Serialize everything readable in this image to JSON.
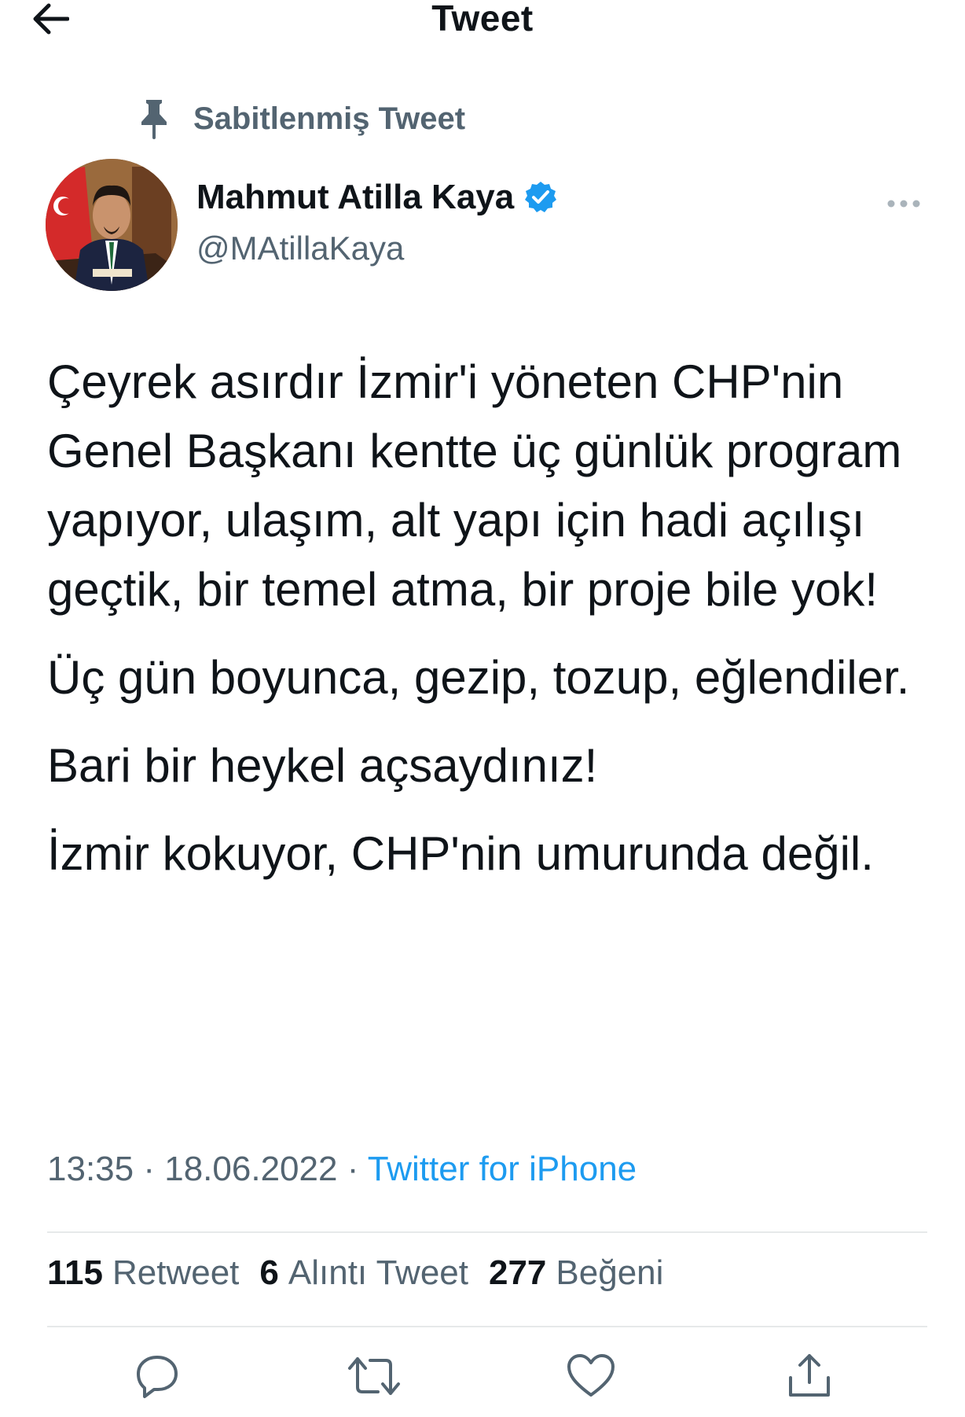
{
  "header": {
    "title": "Tweet",
    "back_icon": "arrow-left-icon"
  },
  "pinned": {
    "icon": "pin-icon",
    "label": "Sabitlenmiş Tweet"
  },
  "author": {
    "display_name": "Mahmut Atilla Kaya",
    "verified": true,
    "handle": "@MAtillaKaya"
  },
  "tweet": {
    "paragraphs": [
      "Çeyrek asırdır İzmir'i yöneten CHP'nin Genel Başkanı kentte üç günlük program yapıyor, ulaşım, alt yapı için hadi açılışı geçtik, bir temel atma, bir proje bile yok!",
      "Üç gün boyunca, gezip, tozup, eğlendiler.",
      "Bari bir heykel açsaydınız!",
      "İzmir kokuyor, CHP'nin umurunda değil."
    ]
  },
  "meta": {
    "time": "13:35",
    "date": "18.06.2022",
    "separator": "·",
    "source": "Twitter for iPhone"
  },
  "stats": {
    "retweets_count": "115",
    "retweets_label": "Retweet",
    "quotes_count": "6",
    "quotes_label": "Alıntı Tweet",
    "likes_count": "277",
    "likes_label": "Beğeni"
  },
  "actions": [
    "reply-icon",
    "retweet-icon",
    "like-icon",
    "share-icon"
  ],
  "colors": {
    "text": "#0f1419",
    "secondary": "#536471",
    "link": "#1d9bf0",
    "divider": "#e6e9ea"
  }
}
